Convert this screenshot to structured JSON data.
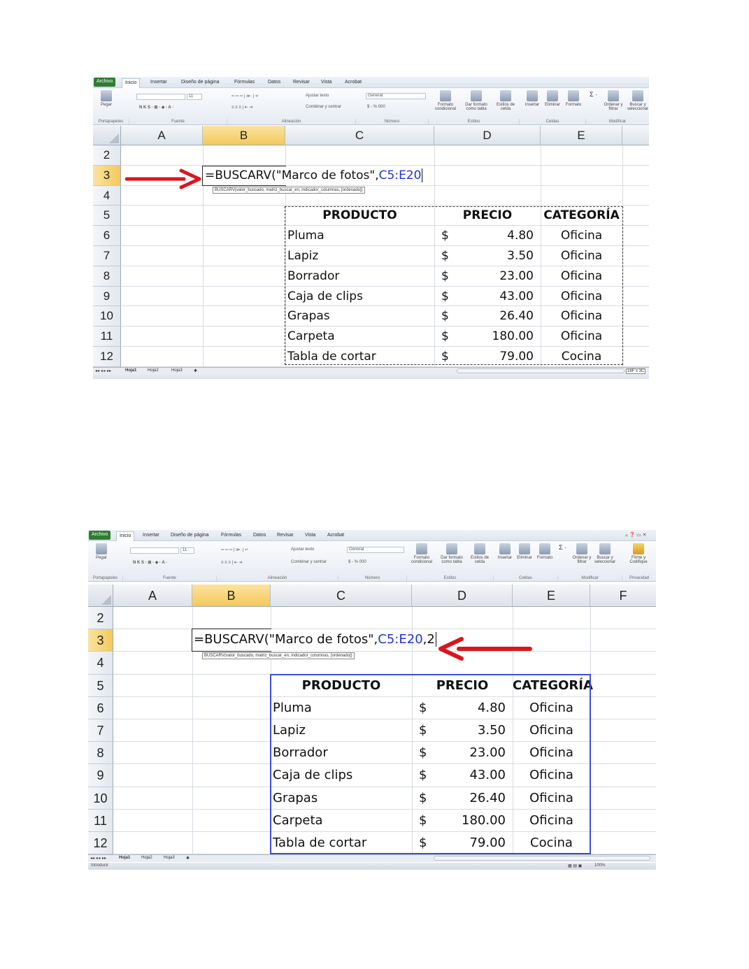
{
  "ribbon": {
    "tabs": [
      "Archivo",
      "Inicio",
      "Insertar",
      "Diseño de página",
      "Fórmulas",
      "Datos",
      "Revisar",
      "Vista",
      "Acrobat"
    ],
    "paste_label": "Pegar",
    "groups": [
      "Portapapeles",
      "Fuente",
      "Alineación",
      "Número",
      "Estilos",
      "Celdas",
      "Modificar",
      "Privacidad"
    ],
    "font_size": "11",
    "wrap_text": "Ajustar texto",
    "merge_center": "Combinar y centrar",
    "number_format": "General",
    "currency_symbols": "$ - % 000",
    "styles": [
      "Formato condicional",
      "Dar formato como tabla",
      "Estilos de celda"
    ],
    "cells": [
      "Insertar",
      "Eliminar",
      "Formato"
    ],
    "edit": [
      "Ordenar y filtrar",
      "Buscar y seleccionar"
    ],
    "privacy": "Firme y Codifique"
  },
  "sheet": {
    "columns": [
      "A",
      "B",
      "C",
      "D",
      "E",
      "F"
    ],
    "rows": [
      "2",
      "3",
      "4",
      "5",
      "6",
      "7",
      "8",
      "9",
      "10",
      "11",
      "12"
    ],
    "headers": [
      "PRODUCTO",
      "PRECIO",
      "CATEGORÍA"
    ],
    "currency": "$",
    "table": [
      [
        "Pluma",
        "4.80",
        "Oficina"
      ],
      [
        "Lapiz",
        "3.50",
        "Oficina"
      ],
      [
        "Borrador",
        "23.00",
        "Oficina"
      ],
      [
        "Caja de clips",
        "43.00",
        "Oficina"
      ],
      [
        "Grapas",
        "26.40",
        "Oficina"
      ],
      [
        "Carpeta",
        "180.00",
        "Oficina"
      ],
      [
        "Tabla de cortar",
        "79.00",
        "Cocina"
      ]
    ],
    "sheet_tabs": [
      "Hoja1",
      "Hoja2",
      "Hoja3"
    ],
    "status_mode": "Introducir",
    "zoom": "100%"
  },
  "shot1": {
    "formula_prefix": "=BUSCARV(\"Marco de fotos\",",
    "formula_range": "C5:E20",
    "formula_suffix": "",
    "tooltip": "BUSCARV(valor_buscado, matriz_buscar_en, indicador_columnas, [ordenado])",
    "dimensions": "16F x 3C"
  },
  "shot2": {
    "formula_prefix": "=BUSCARV(\"Marco de fotos\",",
    "formula_range": "C5:E20",
    "formula_suffix": ",2",
    "tooltip": "BUSCARV(valor_buscado, matriz_buscar_en, indicador_columnas, [ordenado])"
  },
  "colors": {
    "arrow": "#d9161c",
    "selected_header": "#f4c95b",
    "range_blue": "#2134d6"
  }
}
